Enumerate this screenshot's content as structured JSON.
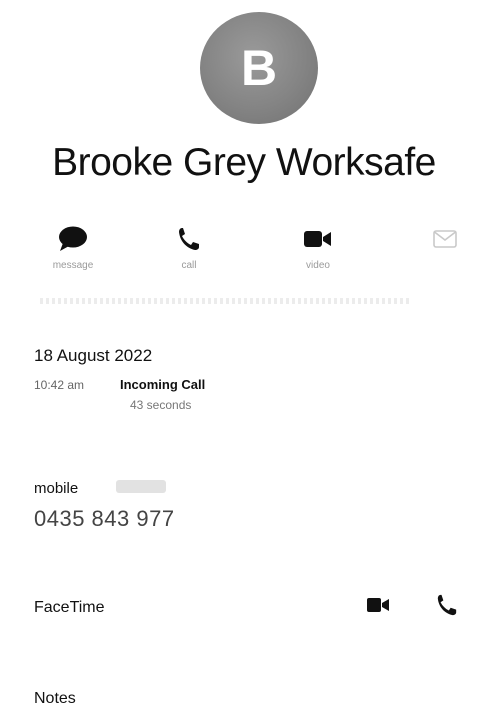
{
  "contact": {
    "initial": "B",
    "name": "Brooke Grey Worksafe"
  },
  "actions": {
    "message": {
      "label": "message",
      "icon": "message-bubble-icon"
    },
    "call": {
      "label": "call",
      "icon": "phone-icon"
    },
    "video": {
      "label": "video",
      "icon": "video-camera-icon"
    },
    "mail": {
      "icon": "mail-icon"
    }
  },
  "history": {
    "date": "18 August 2022",
    "time": "10:42 am",
    "type": "Incoming Call",
    "duration": "43 seconds"
  },
  "phone": {
    "label": "mobile",
    "number": "0435 843 977"
  },
  "facetime": {
    "label": "FaceTime",
    "video_icon": "video-camera-icon",
    "call_icon": "phone-icon"
  },
  "notes": {
    "label": "Notes"
  },
  "colors": {
    "avatar": "#848484",
    "icon": "#111111",
    "secondary_text": "#777777"
  }
}
